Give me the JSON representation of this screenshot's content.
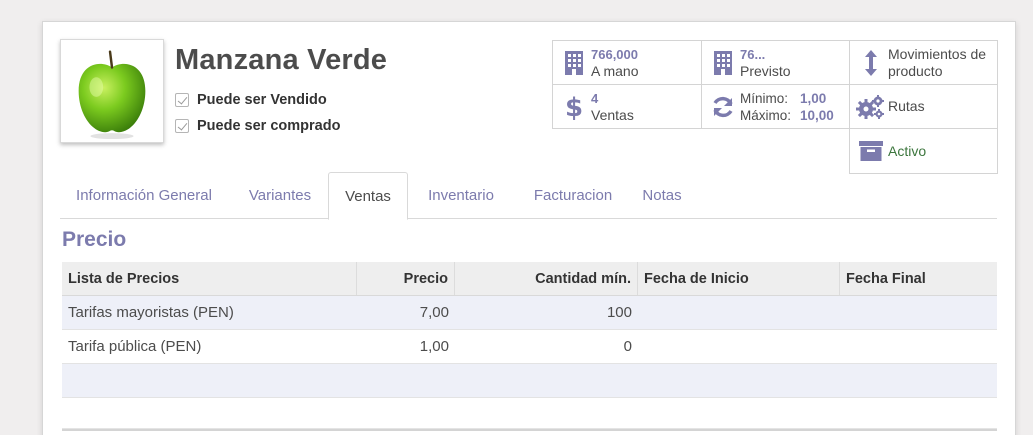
{
  "product": {
    "name": "Manzana Verde",
    "image_alt": "green-apple",
    "can_be_sold_label": "Puede ser Vendido",
    "can_be_purchased_label": "Puede ser comprado"
  },
  "stats": {
    "on_hand": {
      "value": "766,000",
      "label": "A mano",
      "icon": "building-icon"
    },
    "forecast": {
      "value": "76...",
      "label": "Previsto",
      "icon": "building-icon"
    },
    "moves": {
      "label": "Movimientos de producto",
      "icon": "updown-arrow-icon"
    },
    "sales": {
      "value": "4",
      "label": "Ventas",
      "icon": "dollar-icon"
    },
    "reorder": {
      "min_label": "Mínimo:",
      "min_value": "1,00",
      "max_label": "Máximo:",
      "max_value": "10,00",
      "icon": "refresh-icon"
    },
    "routes": {
      "label": "Rutas",
      "icon": "gears-icon"
    },
    "active": {
      "label": "Activo",
      "icon": "archive-icon"
    }
  },
  "tabs": [
    {
      "label": "Información General",
      "active": false
    },
    {
      "label": "Variantes",
      "active": false
    },
    {
      "label": "Ventas",
      "active": true
    },
    {
      "label": "Inventario",
      "active": false
    },
    {
      "label": "Facturacion",
      "active": false
    },
    {
      "label": "Notas",
      "active": false
    }
  ],
  "pricing": {
    "section_title": "Precio",
    "columns": [
      "Lista de Precios",
      "Precio",
      "Cantidad mín.",
      "Fecha de Inicio",
      "Fecha Final"
    ],
    "rows": [
      {
        "pricelist": "Tarifas mayoristas (PEN)",
        "price": "7,00",
        "min_qty": "100",
        "start": "",
        "end": ""
      },
      {
        "pricelist": "Tarifa pública (PEN)",
        "price": "1,00",
        "min_qty": "0",
        "start": "",
        "end": ""
      }
    ]
  },
  "colors": {
    "accent": "#7c7bad",
    "active_green": "#3c763d",
    "text": "#4c4c4c"
  }
}
